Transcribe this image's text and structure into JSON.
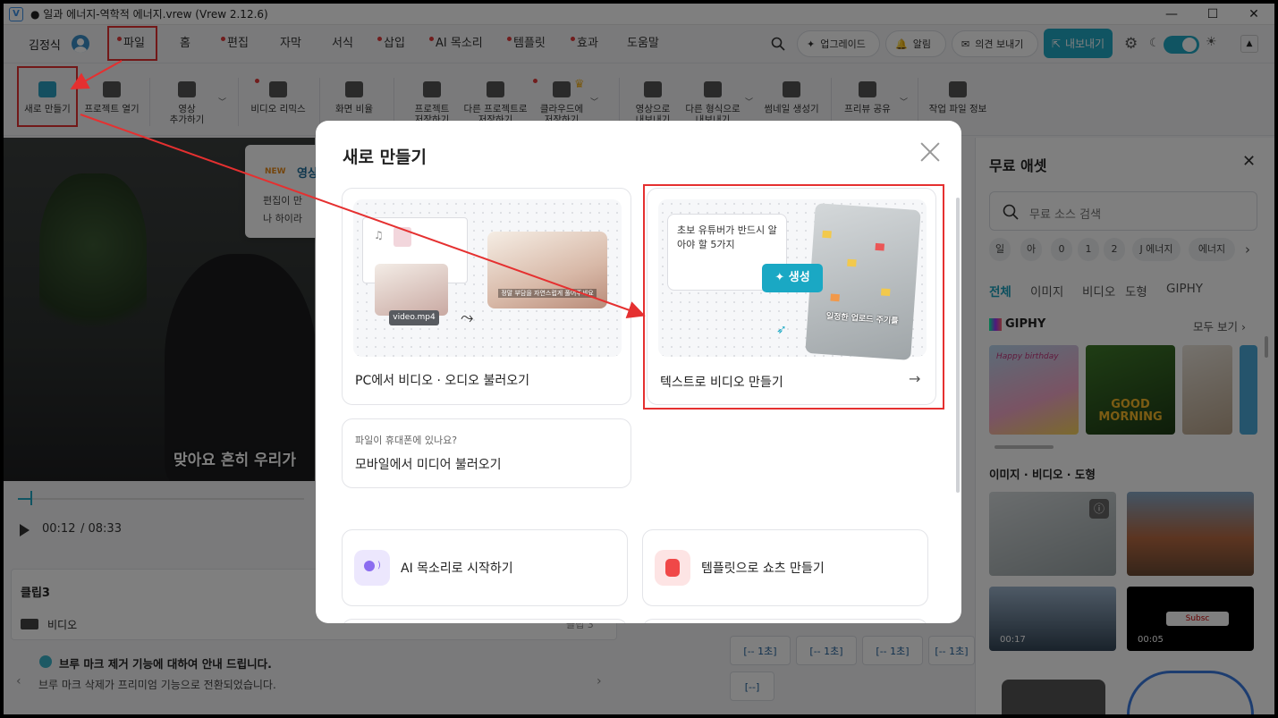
{
  "window": {
    "title": "● 일과 에너지-역학적 에너지.vrew (Vrew 2.12.6)",
    "minimize": "—",
    "maximize": "☐",
    "close": "✕"
  },
  "menubar": {
    "user": "김정식",
    "items": [
      "파일",
      "홈",
      "편집",
      "자막",
      "서식",
      "삽입",
      "AI 목소리",
      "템플릿",
      "효과",
      "도움말"
    ],
    "upgrade": "업그레이드",
    "alerts": "알림",
    "feedback": "의견 보내기",
    "export": "내보내기"
  },
  "toolbar": {
    "new": "새로 만들기",
    "open": "프로젝트 열기",
    "add_video_1": "영상",
    "add_video_2": "추가하기",
    "remix": "비디오 리믹스",
    "ratio": "화면 비율",
    "save_1": "프로젝트",
    "save_2": "저장하기",
    "save_as_1": "다른 프로젝트로",
    "save_as_2": "저장하기",
    "cloud_1": "클라우드에",
    "cloud_2": "저장하기",
    "export_video_1": "영상으로",
    "export_video_2": "내보내기",
    "export_other_1": "다른 형식으로",
    "export_other_2": "내보내기",
    "thumbnail": "썸네일 생성기",
    "share": "프리뷰 공유",
    "info": "작업 파일 정보"
  },
  "tooltip": {
    "badge": "NEW",
    "title": "영상",
    "line1": "편집이 만",
    "line2": "나 하이라"
  },
  "player": {
    "subtitle": "맞아요 흔히 우리가",
    "current_time": "00:12",
    "total_time": "/ 08:33"
  },
  "clip": {
    "title": "클립3",
    "track": "비디오",
    "count": "클립 3"
  },
  "notice": {
    "title": "브루 마크 제거 기능에 대하여 안내 드립니다.",
    "body": "브루 마크 삭제가 프리미엄 기능으로 전환되었습니다."
  },
  "modal": {
    "title": "새로 만들기",
    "pc_label": "PC에서 비디오 · 오디오 불러오기",
    "pc_file": "video.mp4",
    "pc_caption": "정말 부담을 자연스럽게 풀어주세요",
    "text_label": "텍스트로 비디오 만들기",
    "text_prompt": "초보 유튜버가 반드시 알아야 할 5가지",
    "generate": "생성",
    "text_caption": "일정한 업로드 주기를",
    "mobile_hint": "파일이 휴대폰에 있나요?",
    "mobile_label": "모바일에서 미디어 불러오기",
    "ai_voice": "AI 목소리로 시작하기",
    "template": "템플릿으로 쇼츠 만들기",
    "arrow": "→"
  },
  "right_panel": {
    "title": "무료 애셋",
    "search_placeholder": "무료 소스 검색",
    "chips": [
      "일",
      "아",
      "0",
      "1",
      "2",
      "J 에너지",
      "에너지"
    ],
    "tabs": [
      "전체",
      "이미지",
      "비디오",
      "도형",
      "GIPHY"
    ],
    "giphy_title": "GIPHY",
    "see_all": "모두 보기",
    "gif1": "Happy birthday",
    "gif2": "GOOD MORNING",
    "section": "이미지 · 비디오 · 도형",
    "dur1": "00:17",
    "dur2": "00:05",
    "subs": "Subsc"
  },
  "timecodes": [
    "[-- 1초]",
    "[-- 1초]",
    "[-- 1초]",
    "[-- 1초]",
    "[--]"
  ],
  "colors": {
    "accent": "#20a8c4",
    "highlight": "#e53030",
    "dot": "#e23a3a"
  }
}
